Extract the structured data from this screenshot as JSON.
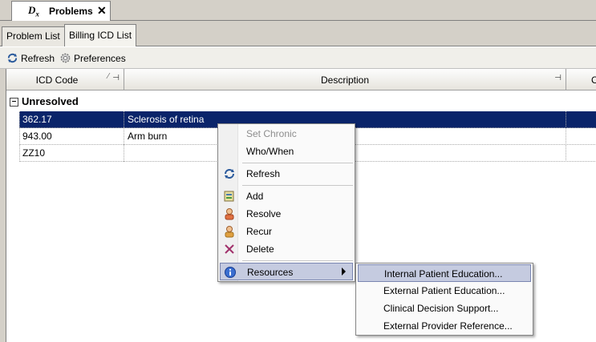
{
  "doc_tab": {
    "logo": "D",
    "logo_sub": "x",
    "title": "Problems",
    "close": "✕"
  },
  "subtabs": [
    {
      "label": "Problem List",
      "active": false
    },
    {
      "label": "Billing ICD List",
      "active": true
    }
  ],
  "toolbar": {
    "refresh_label": "Refresh",
    "preferences_label": "Preferences"
  },
  "columns": {
    "icd_code": "ICD Code",
    "description": "Description",
    "third_col_partial": "C"
  },
  "group": {
    "toggle": "–",
    "label": "Unresolved"
  },
  "rows": [
    {
      "icd": "362.17",
      "description": "Sclerosis of retina",
      "selected": true
    },
    {
      "icd": "943.00",
      "description": "Arm burn",
      "selected": false
    },
    {
      "icd": "ZZ10",
      "description": "",
      "selected": false
    }
  ],
  "context_menu": {
    "items": [
      {
        "label": "Set Chronic",
        "disabled": true,
        "icon": ""
      },
      {
        "label": "Who/When",
        "disabled": false,
        "icon": ""
      },
      {
        "label": "Refresh",
        "disabled": false,
        "icon": "refresh-icon"
      },
      {
        "label": "Add",
        "disabled": false,
        "icon": "add-icon"
      },
      {
        "label": "Resolve",
        "disabled": false,
        "icon": "resolve-icon"
      },
      {
        "label": "Recur",
        "disabled": false,
        "icon": "recur-icon"
      },
      {
        "label": "Delete",
        "disabled": false,
        "icon": "delete-icon"
      },
      {
        "label": "Resources",
        "disabled": false,
        "icon": "info-icon",
        "highlighted": true
      }
    ]
  },
  "submenu": {
    "items": [
      {
        "label": "Internal Patient Education...",
        "highlighted": true
      },
      {
        "label": "External Patient Education..."
      },
      {
        "label": "Clinical Decision Support..."
      },
      {
        "label": "External Provider Reference..."
      }
    ]
  },
  "colors": {
    "selection": "#0a246a",
    "menu_highlight": "#c5cbe0"
  }
}
